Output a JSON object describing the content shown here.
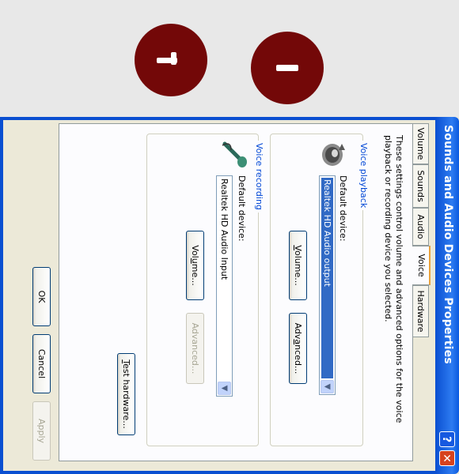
{
  "window": {
    "title": "Sounds and Audio Devices Properties",
    "help_glyph": "?",
    "close_glyph": "✕"
  },
  "tabs": [
    "Volume",
    "Sounds",
    "Audio",
    "Voice",
    "Hardware"
  ],
  "active_tab": "Voice",
  "description": "These settings control volume and advanced options for the voice playback or recording device you selected.",
  "voice_playback": {
    "group_label": "Voice playback",
    "device_label": "Default device:",
    "device_value": "Realtek HD Audio output",
    "volume_key": "V",
    "volume_rest": "olume...",
    "advanced_pre": "Adv",
    "advanced_key": "a",
    "advanced_post": "nced..."
  },
  "voice_recording": {
    "group_label": "Voice recording",
    "device_label": "Default device:",
    "device_value": "Realtek HD Audio Input",
    "volume_pre": "Vol",
    "volume_key": "u",
    "volume_post": "me...",
    "advanced_label": "Advanced..."
  },
  "test_hardware": {
    "key": "T",
    "rest": "est hardware..."
  },
  "footer": {
    "ok": "OK",
    "cancel": "Cancel",
    "apply": "Apply"
  },
  "colors": {
    "title_bar": "#0a5adf",
    "knob": "#730808",
    "group_label": "#0046d5",
    "selection": "#316ac5"
  },
  "icons": {
    "speaker": "speaker-icon",
    "microphone": "microphone-icon",
    "dropdown": "chevron-down-icon"
  }
}
